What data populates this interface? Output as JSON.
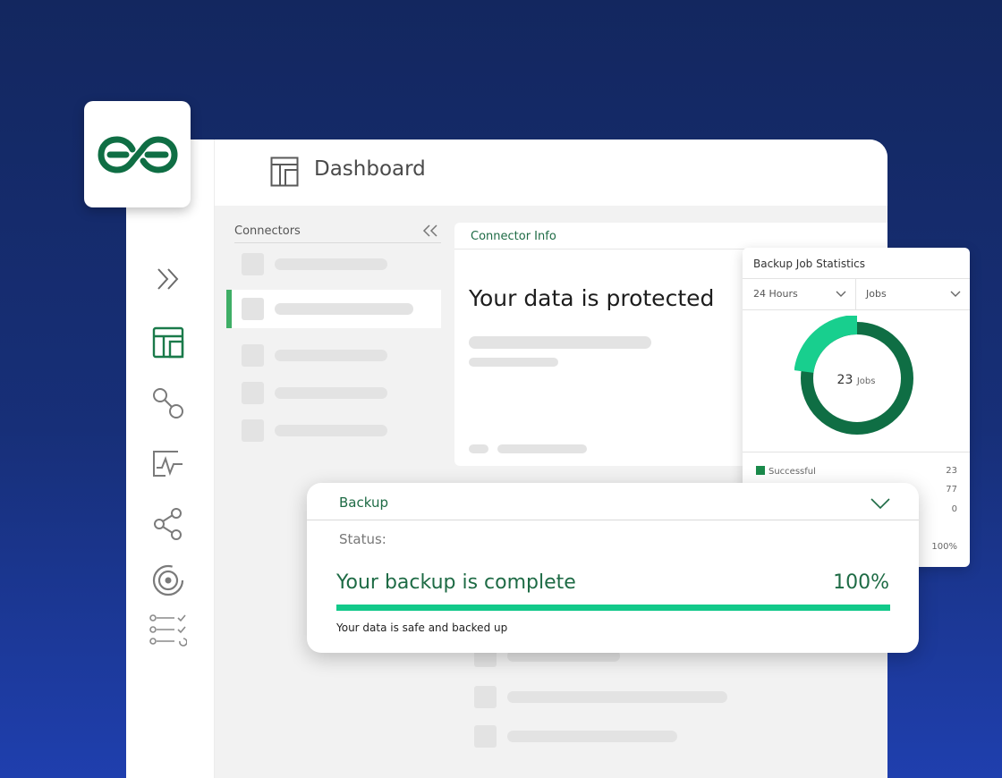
{
  "header": {
    "title": "Dashboard",
    "icon": "dashboard-layout-icon"
  },
  "sidebar": {
    "icons": [
      "expand-icon",
      "dashboard-icon",
      "connections-icon",
      "monitor-icon",
      "share-icon",
      "target-icon",
      "checklist-icon"
    ]
  },
  "connectors": {
    "label": "Connectors",
    "collapse_icon": "double-chevron-left-icon"
  },
  "connector_info": {
    "title": "Connector Info",
    "headline": "Your data is protected"
  },
  "stats": {
    "title": "Backup Job Statistics",
    "period_select": "24 Hours",
    "metric_select": "Jobs",
    "donut": {
      "count": "23",
      "unit": "Jobs",
      "fraction_highlight": 0.23
    },
    "legend": [
      {
        "label": "Successful",
        "value": "23"
      },
      {
        "label": "",
        "value": "77"
      },
      {
        "label": "",
        "value": "0"
      }
    ],
    "footer_pct": "100%",
    "colors": {
      "primary": "#0f6e44",
      "highlight": "#18cf8e"
    }
  },
  "backup": {
    "title": "Backup",
    "status_label": "Status:",
    "message": "Your backup is complete",
    "percent": "100%",
    "progress": 1.0,
    "note": "Your data is safe and backed up"
  },
  "colors": {
    "brand_green": "#0f6e44",
    "accent_green": "#12c98a",
    "background_navy": "#13275f"
  }
}
